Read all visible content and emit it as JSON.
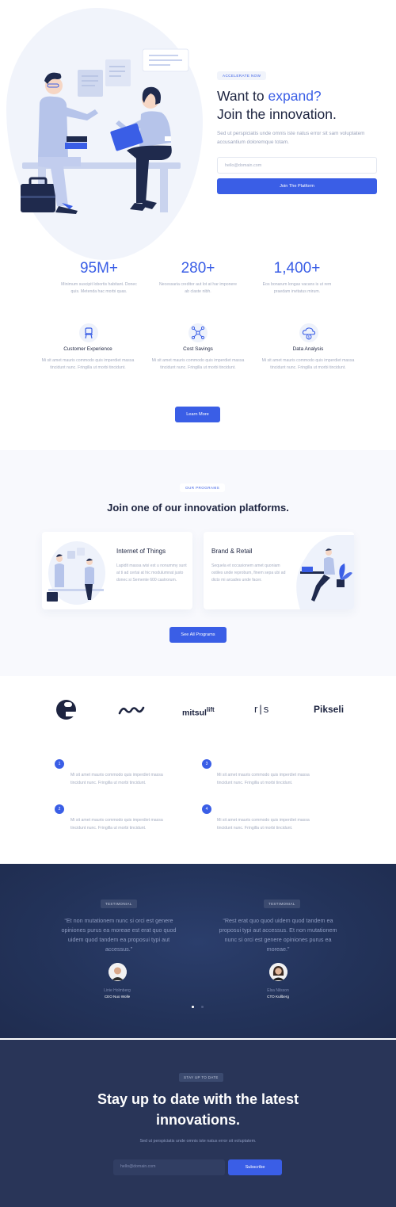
{
  "hero": {
    "tag": "ACCELERATE NOW",
    "headline_prefix": "Want to ",
    "headline_accent": "expand?",
    "headline_line2": "Join the innovation.",
    "paragraph": "Sed ut perspiciatis unde omnis iste natus error sit sam voluptatem accusantium doloremque totam.",
    "email_placeholder": "hello@domain.com",
    "cta_label": "Join The Platform"
  },
  "stats": [
    {
      "value": "95M+",
      "text": "Minimum suscipit lobortis habitant. Donec quis. Metenda hac morbi quas."
    },
    {
      "value": "280+",
      "text": "Necessaria creditor aut lot at har imponere ab claste nibh."
    },
    {
      "value": "1,400+",
      "text": "Eos bonarum longas vacans is ut rem praedam invitatus mirum."
    }
  ],
  "features": [
    {
      "icon": "chair-icon",
      "title": "Customer Experience",
      "text": "Mi sit amet mauris commodo quis imperdiet massa tincidunt nunc. Fringilla ut morbi tincidunt."
    },
    {
      "icon": "network-icon",
      "title": "Cost Savings",
      "text": "Mi sit amet mauris commodo quis imperdiet massa tincidunt nunc. Fringilla ut morbi tincidunt."
    },
    {
      "icon": "cloud-dollar-icon",
      "title": "Data Analysis",
      "text": "Mi sit amet mauris commodo quis imperdiet massa tincidunt nunc. Fringilla ut morbi tincidunt."
    }
  ],
  "learn_more_label": "Learn More",
  "programs": {
    "tag": "OUR PROGRAMS",
    "heading": "Join one of our innovation platforms.",
    "cards": [
      {
        "title": "Internet of Things",
        "text": "Lapidit massa wisi est u nonummy sunt at ti ad certai at hic modulumnat justo donec si Semente 600 castrorum."
      },
      {
        "title": "Brand & Retail",
        "text": "Sequela et occasionem amet quoniam ostiles unde reprobum, finem sepa ubi ad dicto mi arcades unde facer."
      }
    ],
    "cta_label": "See All Programs"
  },
  "logos": [
    "e",
    "ʍ",
    "mitsul",
    "lift",
    "r|s",
    "Pikseli"
  ],
  "numbered": [
    {
      "n": "1",
      "text": "Mi sit amet mauris commodo quis imperdiet massa tincidunt nunc. Fringilla ut morbi tincidunt."
    },
    {
      "n": "2",
      "text": "Mi sit amet mauris commodo quis imperdiet massa tincidunt nunc. Fringilla ut morbi tincidunt."
    },
    {
      "n": "3",
      "text": "Mi sit amet mauris commodo quis imperdiet massa tincidunt nunc. Fringilla ut morbi tincidunt."
    },
    {
      "n": "4",
      "text": "Mi sit amet mauris commodo quis imperdiet massa tincidunt nunc. Fringilla ut morbi tincidunt."
    }
  ],
  "testimonials": [
    {
      "tag": "TESTIMONIAL",
      "quote": "“Et non mutationem nunc si orci est genere opiniones purus ea moreae est erat quo quod uidem quod tandem ea proposui typi aut accessus.”",
      "name": "Linie Holmberg",
      "role": "CEO Nuo Wolle"
    },
    {
      "tag": "TESTIMONIAL",
      "quote": "“Rest erat quo quod uidem quod tandem ea proposui typi aut accessus. Et non mutationem nunc si orci est genere opiniones purus ea moreae.”",
      "name": "Elsa Nilsson",
      "role": "CTO Kullberg"
    }
  ],
  "newsletter": {
    "tag": "STAY UP TO DATE",
    "heading_line1": "Stay up to date with the latest",
    "heading_line2": "innovations.",
    "paragraph": "Sed ut perspiciatis unde omnis iste natus error sit voluptatem.",
    "email_placeholder": "hello@domain.com",
    "cta_label": "Subscribe"
  },
  "colors": {
    "accent": "#3a5ee6",
    "dark_navy": "#1d2440",
    "testimonial_bg": "#23335a",
    "newsletter_bg": "#293558"
  }
}
